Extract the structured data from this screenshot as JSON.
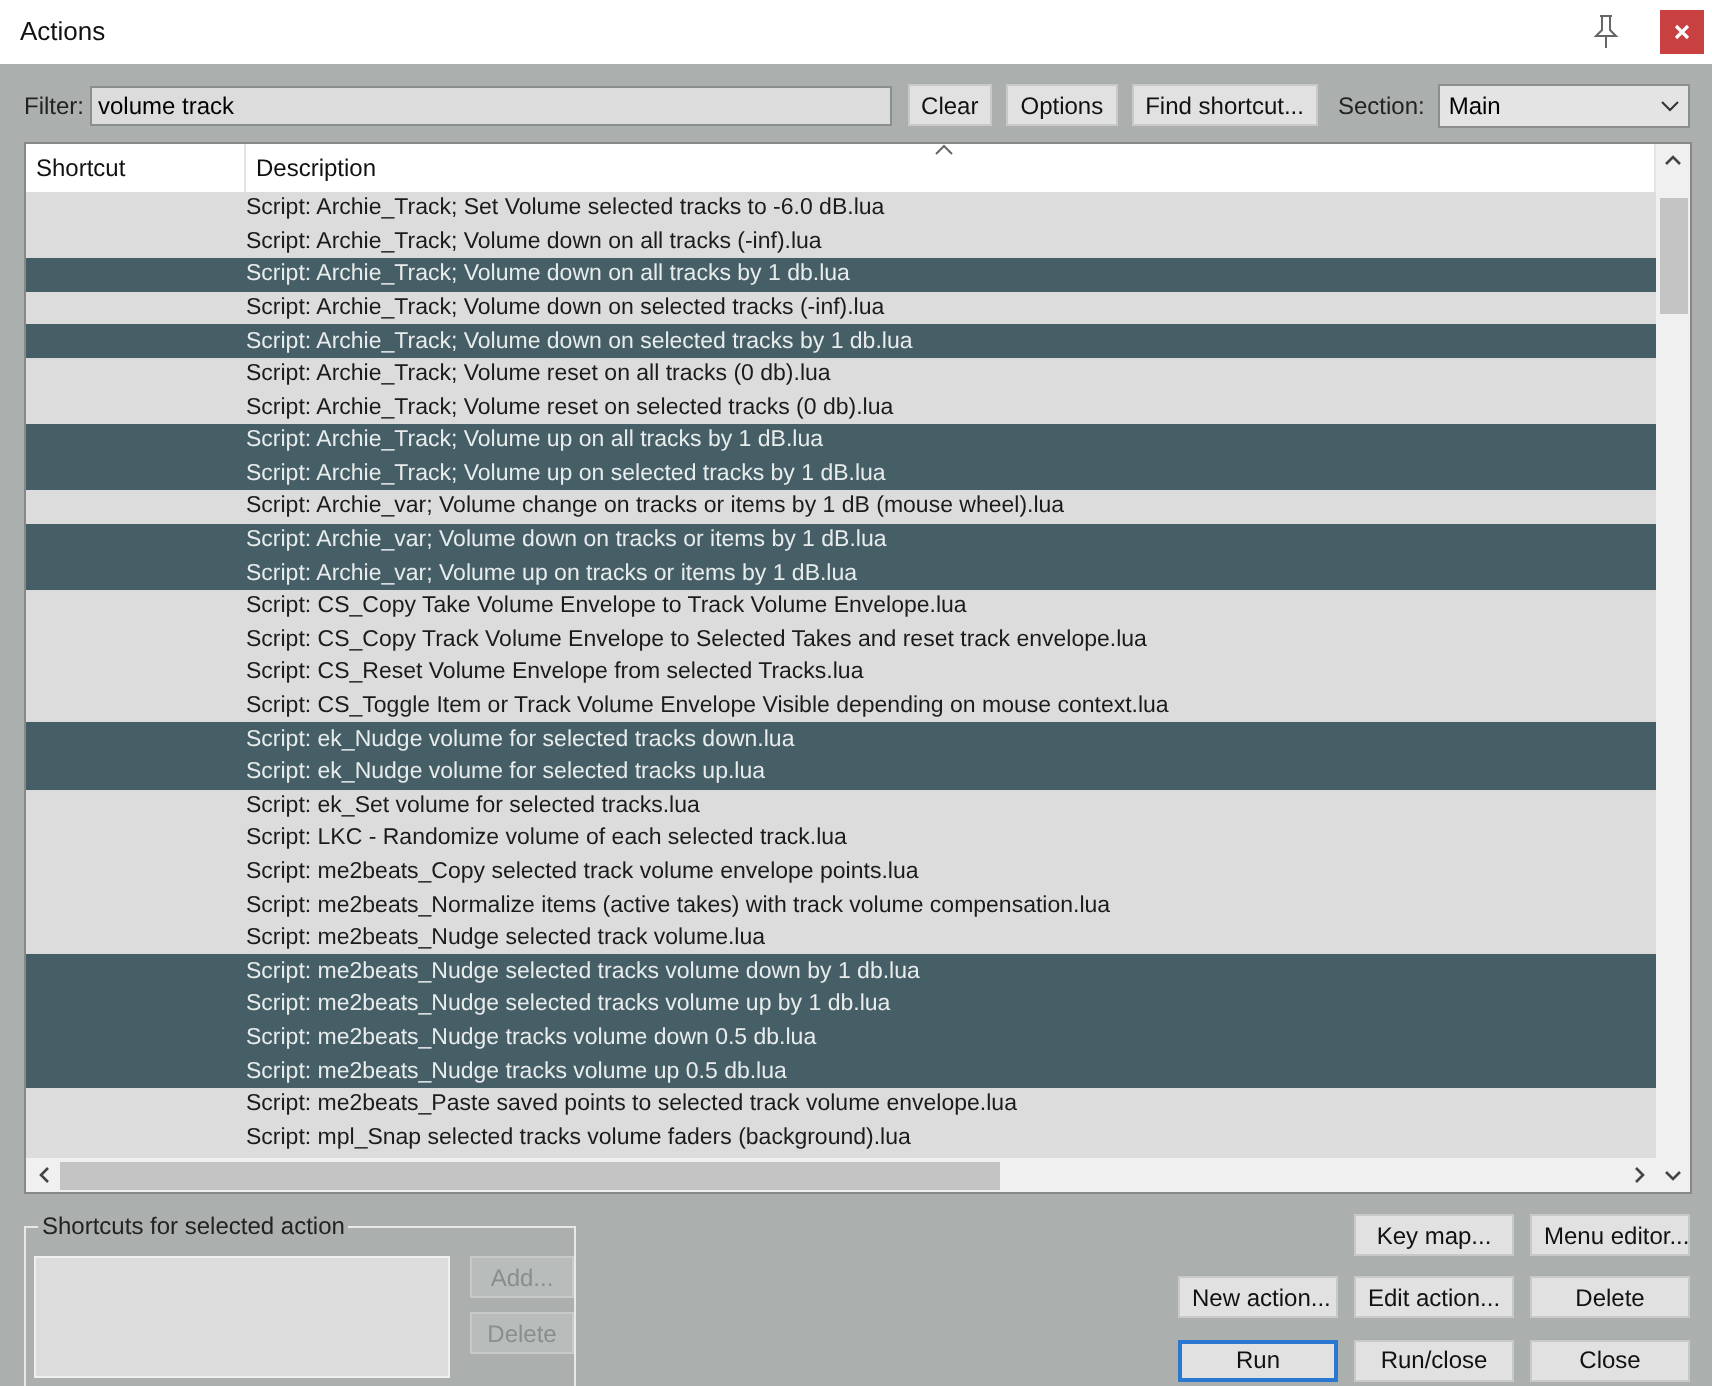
{
  "window": {
    "title": "Actions"
  },
  "filter": {
    "label": "Filter:",
    "value": "volume track"
  },
  "filter_buttons": [
    {
      "label": "Clear"
    },
    {
      "label": "Options"
    },
    {
      "label": "Find shortcut..."
    }
  ],
  "section": {
    "label": "Section:",
    "value": "Main"
  },
  "table": {
    "columns": [
      "Shortcut",
      "Description"
    ],
    "rows": [
      {
        "description": "Script: Archie_Track; Set Volume selected tracks to -6.0 dB.lua",
        "selected": false
      },
      {
        "description": "Script: Archie_Track; Volume down on all tracks (-inf).lua",
        "selected": false
      },
      {
        "description": "Script: Archie_Track; Volume down on all tracks by 1 db.lua",
        "selected": true
      },
      {
        "description": "Script: Archie_Track; Volume down on selected tracks (-inf).lua",
        "selected": false
      },
      {
        "description": "Script: Archie_Track; Volume down on selected tracks by 1 db.lua",
        "selected": true
      },
      {
        "description": "Script: Archie_Track; Volume reset on all tracks (0 db).lua",
        "selected": false
      },
      {
        "description": "Script: Archie_Track; Volume reset on selected tracks (0 db).lua",
        "selected": false
      },
      {
        "description": "Script: Archie_Track; Volume up on all tracks by 1 dB.lua",
        "selected": true
      },
      {
        "description": "Script: Archie_Track; Volume up on selected tracks by 1 dB.lua",
        "selected": true
      },
      {
        "description": "Script: Archie_var; Volume change on tracks or items by 1 dB (mouse wheel).lua",
        "selected": false
      },
      {
        "description": "Script: Archie_var; Volume down on tracks or items by 1 dB.lua",
        "selected": true
      },
      {
        "description": "Script: Archie_var; Volume up on tracks or items by 1 dB.lua",
        "selected": true
      },
      {
        "description": "Script: CS_Copy Take Volume Envelope to Track Volume Envelope.lua",
        "selected": false
      },
      {
        "description": "Script: CS_Copy Track Volume Envelope to Selected Takes and reset track envelope.lua",
        "selected": false
      },
      {
        "description": "Script: CS_Reset Volume Envelope from selected Tracks.lua",
        "selected": false
      },
      {
        "description": "Script: CS_Toggle Item or Track Volume Envelope Visible depending on mouse context.lua",
        "selected": false
      },
      {
        "description": "Script: ek_Nudge volume for selected tracks down.lua",
        "selected": true
      },
      {
        "description": "Script: ek_Nudge volume for selected tracks up.lua",
        "selected": true
      },
      {
        "description": "Script: ek_Set volume for selected tracks.lua",
        "selected": false
      },
      {
        "description": "Script: LKC - Randomize volume of each selected track.lua",
        "selected": false
      },
      {
        "description": "Script: me2beats_Copy selected track volume envelope points.lua",
        "selected": false
      },
      {
        "description": "Script: me2beats_Normalize items (active takes) with track volume compensation.lua",
        "selected": false
      },
      {
        "description": "Script: me2beats_Nudge selected track volume.lua",
        "selected": false
      },
      {
        "description": "Script: me2beats_Nudge selected tracks volume down by 1 db.lua",
        "selected": true
      },
      {
        "description": "Script: me2beats_Nudge selected tracks volume up by 1 db.lua",
        "selected": true
      },
      {
        "description": "Script: me2beats_Nudge tracks volume down 0.5 db.lua",
        "selected": true
      },
      {
        "description": "Script: me2beats_Nudge tracks volume up 0.5 db.lua",
        "selected": true
      },
      {
        "description": "Script: me2beats_Paste saved points to selected track volume envelope.lua",
        "selected": false
      },
      {
        "description": "Script: mpl_Snap selected tracks volume faders (background).lua",
        "selected": false
      }
    ]
  },
  "shortcuts_group": {
    "title": "Shortcuts for selected action",
    "buttons": [
      {
        "label": "Add...",
        "disabled": true
      },
      {
        "label": "Delete",
        "disabled": true
      }
    ]
  },
  "action_buttons": [
    [
      {
        "label": "Key map...",
        "default": false
      },
      {
        "label": "Menu editor...",
        "default": false
      }
    ],
    [
      {
        "label": "New action...",
        "default": false
      },
      {
        "label": "Edit action...",
        "default": false
      },
      {
        "label": "Delete",
        "default": false
      }
    ],
    [
      {
        "label": "Run",
        "default": true
      },
      {
        "label": "Run/close",
        "default": false
      },
      {
        "label": "Close",
        "default": false
      }
    ]
  ]
}
